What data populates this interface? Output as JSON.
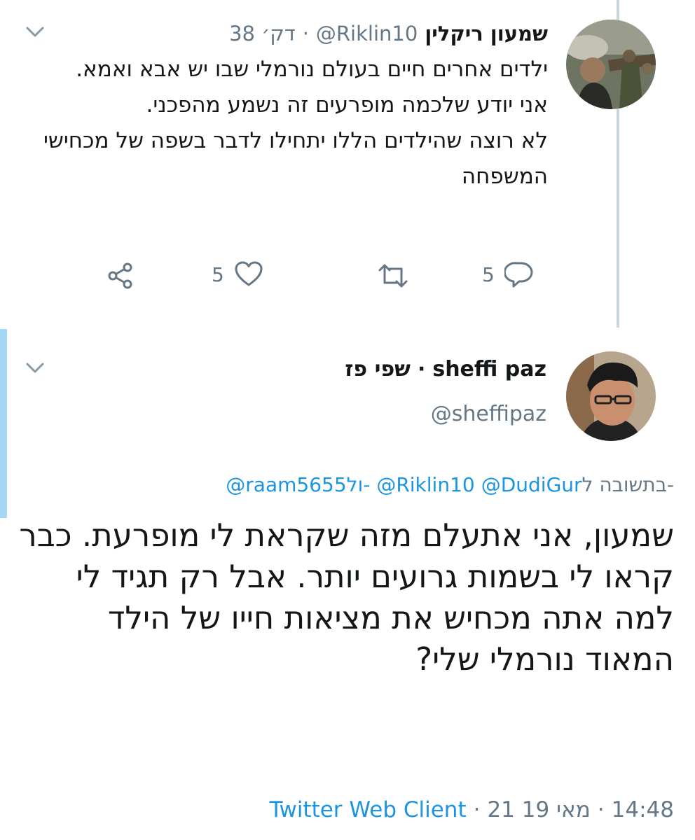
{
  "parent_tweet": {
    "author_name": "שמעון ריקלין",
    "handle": "@Riklin10",
    "separator": "·",
    "time": "38 דק׳",
    "text_lines": [
      "ילדים אחרים חיים בעולם נורמלי שבו יש אבא ואמא.",
      "אני יודע שלכמה מופרעים זה נשמע מהפכני.",
      "לא רוצה שהילדים הללו יתחילו לדבר בשפה של מכחישי המשפחה"
    ],
    "reply_count": "5",
    "like_count": "5",
    "icons": {
      "reply": "reply-icon",
      "retweet": "retweet-icon",
      "like": "heart-icon",
      "share": "share-icon",
      "more": "chevron-down-icon"
    }
  },
  "focus_tweet": {
    "display_name": "sheffi paz",
    "separator": "·",
    "display_name_he": "שפי פז",
    "handle": "@sheffipaz",
    "reply_prefix": "בתשובה ל-",
    "mention_1": "@DudiGur",
    "mention_2": "@Riklin10",
    "mention_3_and": "ול-",
    "mention_3": "@raam5655",
    "text": "שמעון, אני אתעלם מזה שקראת לי מופרעת. כבר קראו לי בשמות גרועים יותר. אבל רק תגיד לי למה אתה מכחיש את מציאות חייו של הילד המאוד נורמלי שלי?",
    "time": "14:48",
    "date": "21 מאי 19",
    "client": "Twitter Web Client"
  },
  "colors": {
    "text": "#14171a",
    "secondary": "#657786",
    "link": "#1b95e0",
    "thread_line": "#ccd6dd",
    "focus_bar": "#a6d6f7"
  }
}
